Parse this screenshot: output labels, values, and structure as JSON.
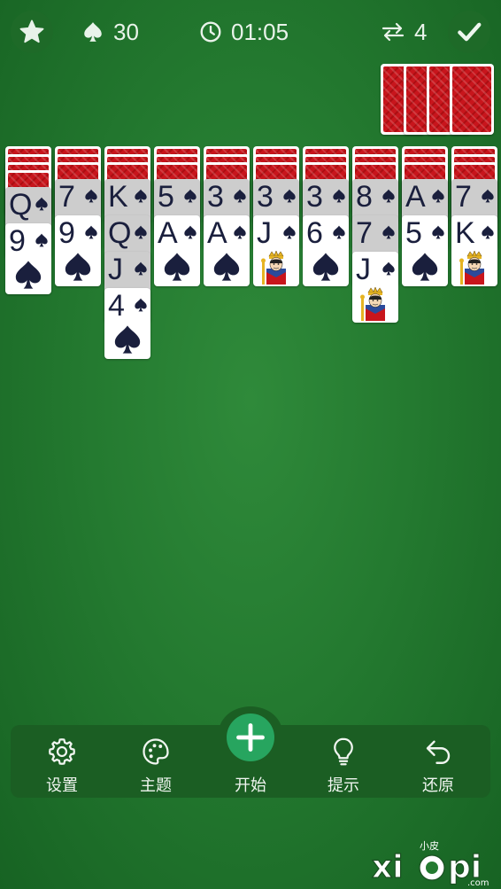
{
  "top_bar": {
    "score": "30",
    "timer": "01:05",
    "moves": "4"
  },
  "stock": {
    "remaining_deals": 4
  },
  "tableau": [
    {
      "hidden": 4,
      "cards": [
        {
          "rank": "Q",
          "suit": "spade",
          "highlight": true
        },
        {
          "rank": "9",
          "suit": "spade",
          "highlight": false
        }
      ]
    },
    {
      "hidden": 3,
      "cards": [
        {
          "rank": "7",
          "suit": "spade",
          "highlight": true
        },
        {
          "rank": "9",
          "suit": "spade",
          "highlight": false
        }
      ]
    },
    {
      "hidden": 3,
      "cards": [
        {
          "rank": "K",
          "suit": "spade",
          "highlight": true
        },
        {
          "rank": "Q",
          "suit": "spade",
          "highlight": true
        },
        {
          "rank": "J",
          "suit": "spade",
          "highlight": true
        },
        {
          "rank": "4",
          "suit": "spade",
          "highlight": false
        }
      ]
    },
    {
      "hidden": 3,
      "cards": [
        {
          "rank": "5",
          "suit": "spade",
          "highlight": true
        },
        {
          "rank": "A",
          "suit": "spade",
          "highlight": false
        }
      ]
    },
    {
      "hidden": 3,
      "cards": [
        {
          "rank": "3",
          "suit": "spade",
          "highlight": true
        },
        {
          "rank": "A",
          "suit": "spade",
          "highlight": false
        }
      ]
    },
    {
      "hidden": 3,
      "cards": [
        {
          "rank": "3",
          "suit": "spade",
          "highlight": true
        },
        {
          "rank": "J",
          "suit": "spade",
          "highlight": false,
          "portrait": true
        }
      ]
    },
    {
      "hidden": 3,
      "cards": [
        {
          "rank": "3",
          "suit": "spade",
          "highlight": true
        },
        {
          "rank": "6",
          "suit": "spade",
          "highlight": false
        }
      ]
    },
    {
      "hidden": 3,
      "cards": [
        {
          "rank": "8",
          "suit": "spade",
          "highlight": true
        },
        {
          "rank": "7",
          "suit": "spade",
          "highlight": true
        },
        {
          "rank": "J",
          "suit": "spade",
          "highlight": false,
          "portrait": true
        }
      ]
    },
    {
      "hidden": 3,
      "cards": [
        {
          "rank": "A",
          "suit": "spade",
          "highlight": true
        },
        {
          "rank": "5",
          "suit": "spade",
          "highlight": false
        }
      ]
    },
    {
      "hidden": 3,
      "cards": [
        {
          "rank": "7",
          "suit": "spade",
          "highlight": true
        },
        {
          "rank": "K",
          "suit": "spade",
          "highlight": false,
          "portrait": true
        }
      ]
    }
  ],
  "toolbar": {
    "settings_label": "设置",
    "theme_label": "主题",
    "start_label": "开始",
    "hint_label": "提示",
    "undo_label": "还原"
  },
  "watermark": {
    "small_text": "小皮",
    "brand": "xiaopi",
    "domain": ".com"
  },
  "colors": {
    "felt": "#247a30",
    "toolbar": "#1b5e23",
    "accent_green": "#27a55f",
    "card_back_red": "#c8151c",
    "ink": "#1a1f3d"
  },
  "icons": {
    "top_left": "star-icon",
    "score": "spade-icon",
    "timer": "clock-icon",
    "moves": "swap-arrows-icon",
    "top_right": "checkmark-icon"
  }
}
